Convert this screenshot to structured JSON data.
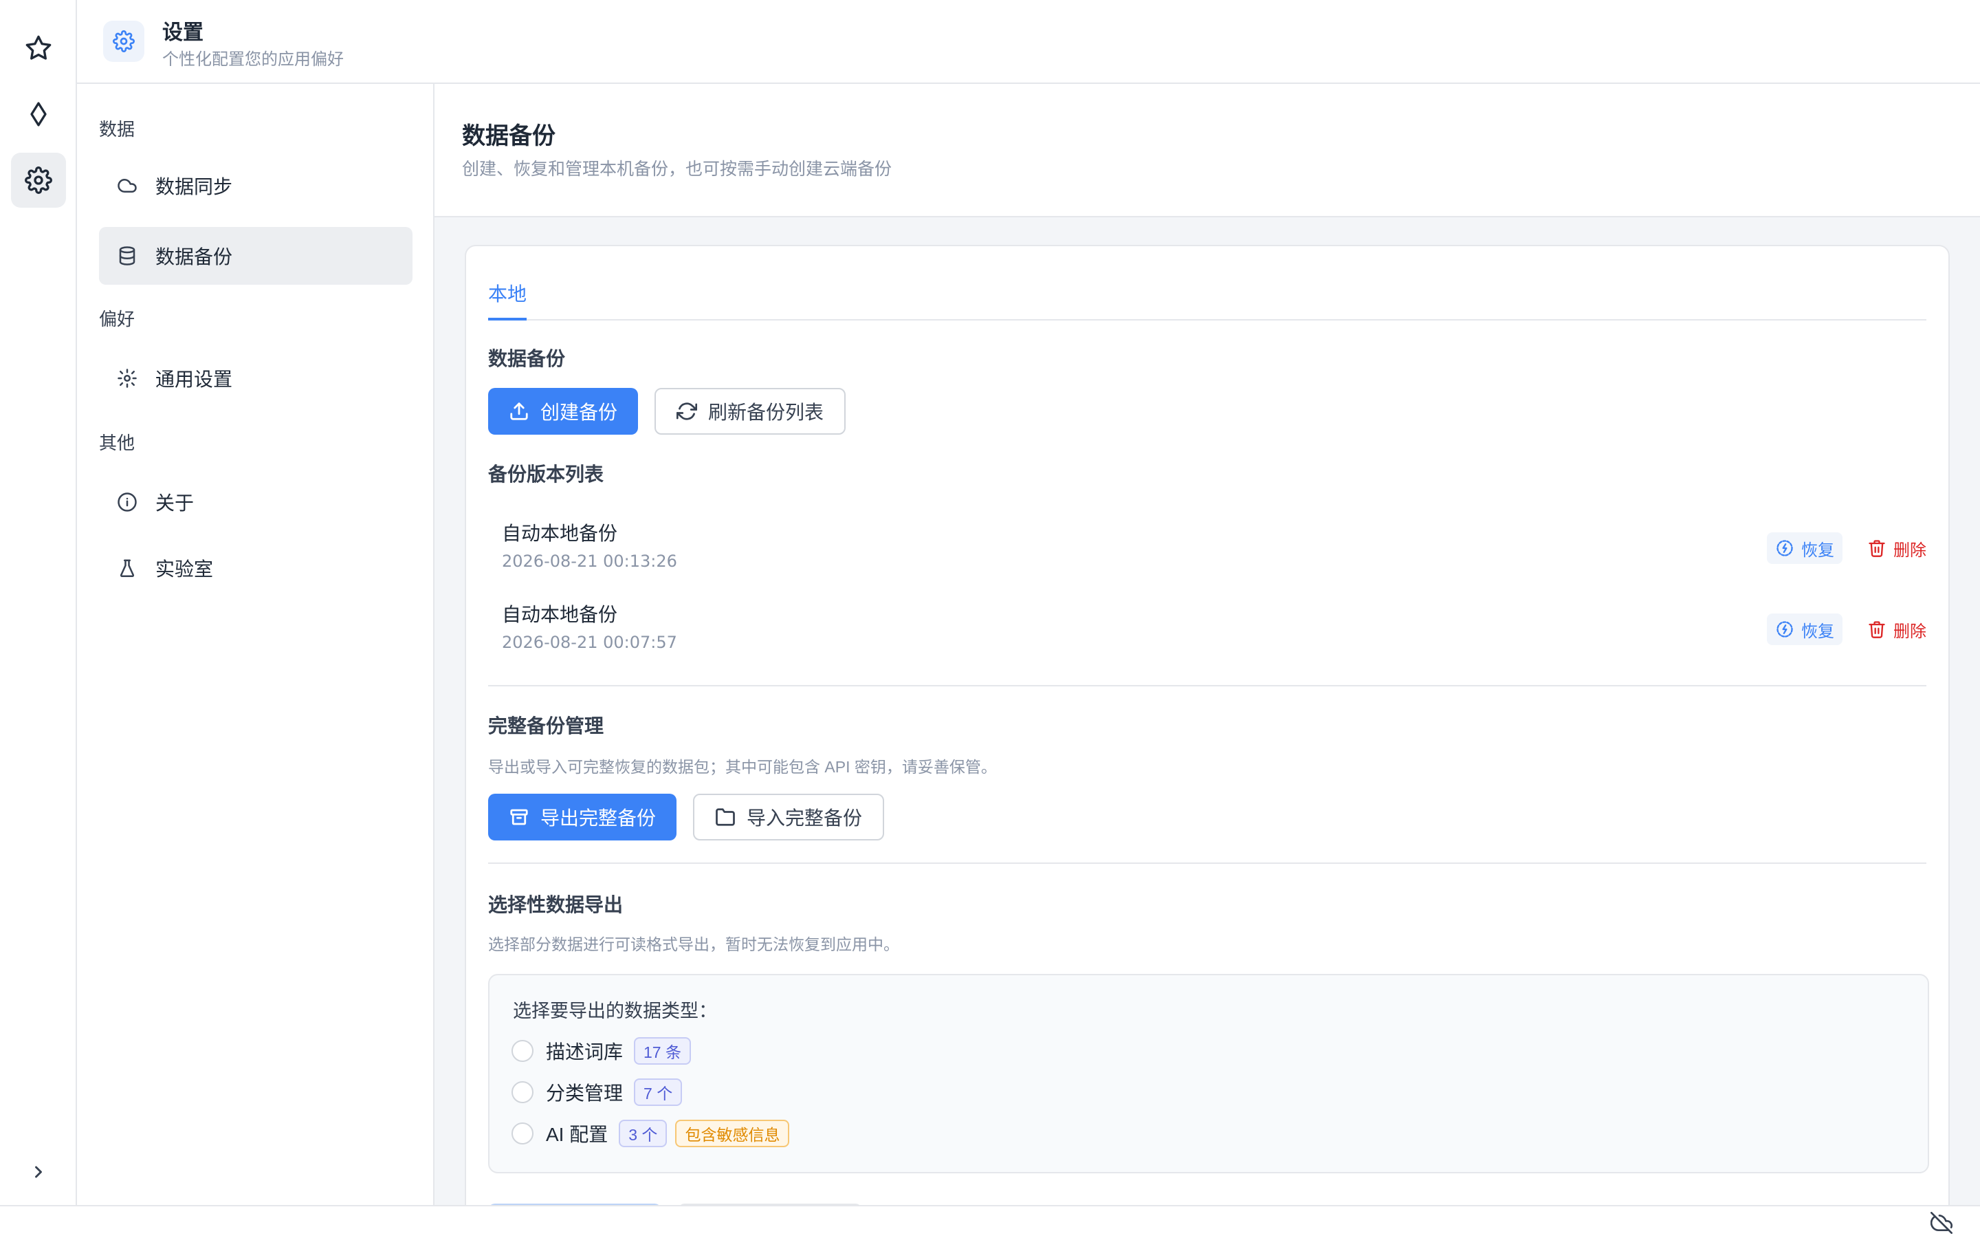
{
  "header": {
    "title": "设置",
    "subtitle": "个性化配置您的应用偏好",
    "icon": "gear-icon"
  },
  "rail": {
    "items": [
      "star-icon",
      "diamond-icon",
      "gear-icon"
    ],
    "active": "gear-icon",
    "expand_icon": "chevron-right-icon"
  },
  "nav": {
    "groups": [
      {
        "label": "数据",
        "items": [
          {
            "label": "数据同步",
            "icon": "cloud-icon"
          },
          {
            "label": "数据备份",
            "icon": "database-icon",
            "active": true
          }
        ]
      },
      {
        "label": "偏好",
        "items": [
          {
            "label": "通用设置",
            "icon": "gear-icon"
          }
        ]
      },
      {
        "label": "其他",
        "items": [
          {
            "label": "关于",
            "icon": "info-icon"
          },
          {
            "label": "实验室",
            "icon": "flask-icon"
          }
        ]
      }
    ]
  },
  "page": {
    "title": "数据备份",
    "subtitle": "创建、恢复和管理本机备份，也可按需手动创建云端备份"
  },
  "tabs": [
    {
      "label": "本地",
      "active": true
    }
  ],
  "backup": {
    "title": "数据备份",
    "create_label": "创建备份",
    "refresh_label": "刷新备份列表",
    "list_title": "备份版本列表",
    "items": [
      {
        "name": "自动本地备份",
        "time": "2026-08-21 00:13:26"
      },
      {
        "name": "自动本地备份",
        "time": "2026-08-21 00:07:57"
      }
    ],
    "restore_label": "恢复",
    "delete_label": "删除"
  },
  "full": {
    "title": "完整备份管理",
    "desc": "导出或导入可完整恢复的数据包；其中可能包含 API 密钥，请妥善保管。",
    "export_label": "导出完整备份",
    "import_label": "导入完整备份"
  },
  "selective": {
    "title": "选择性数据导出",
    "desc": "选择部分数据进行可读格式导出，暂时无法恢复到应用中。",
    "label": "选择要导出的数据类型：",
    "options": [
      {
        "label": "描述词库",
        "count": "17 条"
      },
      {
        "label": "分类管理",
        "count": "7 个"
      },
      {
        "label": "AI 配置",
        "count": "3 个",
        "warn": "包含敏感信息"
      }
    ]
  },
  "colors": {
    "accent": "#3b82f6",
    "danger": "#dc2626",
    "warning": "#e08a00"
  },
  "status": {
    "icon": "cloud-off-icon"
  }
}
